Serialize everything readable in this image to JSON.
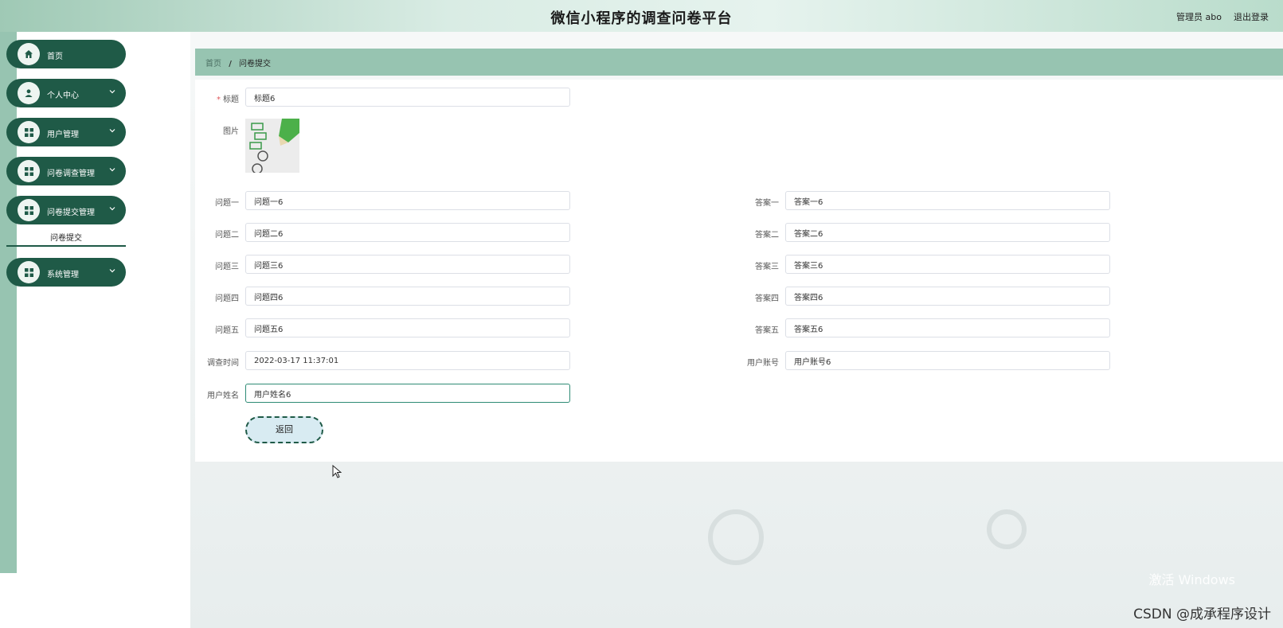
{
  "header": {
    "title": "微信小程序的调查问卷平台",
    "user": "管理员 abo",
    "logout": "退出登录"
  },
  "sidebar": {
    "items": [
      {
        "label": "首页"
      },
      {
        "label": "个人中心"
      },
      {
        "label": "用户管理"
      },
      {
        "label": "问卷调查管理"
      },
      {
        "label": "问卷提交管理"
      },
      {
        "label": "系统管理"
      }
    ],
    "submenu": {
      "label": "问卷提交"
    }
  },
  "breadcrumb": {
    "home": "首页",
    "sep": "/",
    "current": "问卷提交"
  },
  "form": {
    "title_label": "标题",
    "title_value": "标题6",
    "image_label": "图片",
    "q1_label": "问题一",
    "q1_value": "问题一6",
    "q2_label": "问题二",
    "q2_value": "问题二6",
    "q3_label": "问题三",
    "q3_value": "问题三6",
    "q4_label": "问题四",
    "q4_value": "问题四6",
    "q5_label": "问题五",
    "q5_value": "问题五6",
    "a1_label": "答案一",
    "a1_value": "答案一6",
    "a2_label": "答案二",
    "a2_value": "答案二6",
    "a3_label": "答案三",
    "a3_value": "答案三6",
    "a4_label": "答案四",
    "a4_value": "答案四6",
    "a5_label": "答案五",
    "a5_value": "答案五6",
    "time_label": "调查时间",
    "time_value": "2022-03-17 11:37:01",
    "account_label": "用户账号",
    "account_value": "用户账号6",
    "name_label": "用户姓名",
    "name_value": "用户姓名6",
    "back_label": "返回"
  },
  "watermark": {
    "line": "激活 Windows"
  },
  "csdn": "CSDN @成承程序设计",
  "colors": {
    "sidebar_green": "#1f5a47",
    "header_green": "#97c4b1",
    "required_red": "#e0575b"
  }
}
